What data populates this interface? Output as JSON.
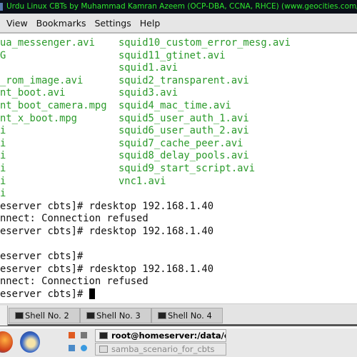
{
  "window": {
    "title": "Urdu Linux CBTs by Muhammad Kamran Azeem (OCP-DBA, CCNA, RHCE) (www.geocities.com/mk_azeem)"
  },
  "menu": [
    "View",
    "Bookmarks",
    "Settings",
    "Help"
  ],
  "terminal": {
    "listing": [
      [
        "ua_messenger.avi",
        "squid10_custom_error_mesg.avi"
      ],
      [
        "G",
        "squid11_gtinet.avi"
      ],
      [
        "",
        "squid1.avi"
      ],
      [
        "_rom_image.avi",
        "squid2_transparent.avi"
      ],
      [
        "nt_boot.avi",
        "squid3.avi"
      ],
      [
        "nt_boot_camera.mpg",
        "squid4_mac_time.avi"
      ],
      [
        "nt_x_boot.mpg",
        "squid5_user_auth_1.avi"
      ],
      [
        "i",
        "squid6_user_auth_2.avi"
      ],
      [
        "i",
        "squid7_cache_peer.avi"
      ],
      [
        "i",
        "squid8_delay_pools.avi"
      ],
      [
        "i",
        "squid9_start_script.avi"
      ],
      [
        "i",
        "vnc1.avi"
      ],
      [
        "i",
        ""
      ]
    ],
    "lines": [
      "eserver cbts]# rdesktop 192.168.1.40",
      "nnect: Connection refused",
      "eserver cbts]# rdesktop 192.168.1.40",
      "",
      "eserver cbts]#",
      "eserver cbts]# rdesktop 192.168.1.40",
      "nnect: Connection refused",
      "eserver cbts]# "
    ]
  },
  "tabs": [
    "Shell No. 2",
    "Shell No. 3",
    "Shell No. 4"
  ],
  "taskbar": {
    "items": [
      "root@homeserver:/data/cdi",
      "samba_scenario_for_cbts"
    ]
  },
  "colors": {
    "listing": "#2a9a2a",
    "title_text": "#2ee82e"
  }
}
